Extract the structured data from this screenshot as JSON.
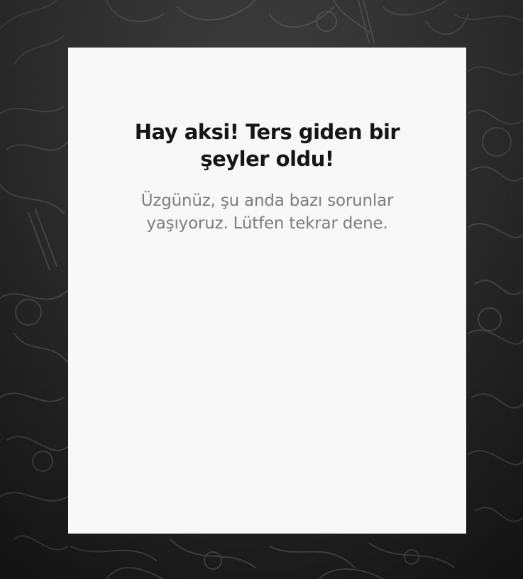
{
  "colors": {
    "page_background": "#2a2a2a",
    "card_background": "#f8f8f8",
    "title_color": "#161616",
    "message_color": "#7d7d7d"
  },
  "error": {
    "title": "Hay aksi! Ters giden bir şeyler oldu!",
    "message": "Üzgünüz, şu anda bazı sorunlar yaşıyoruz. Lütfen tekrar dene."
  }
}
